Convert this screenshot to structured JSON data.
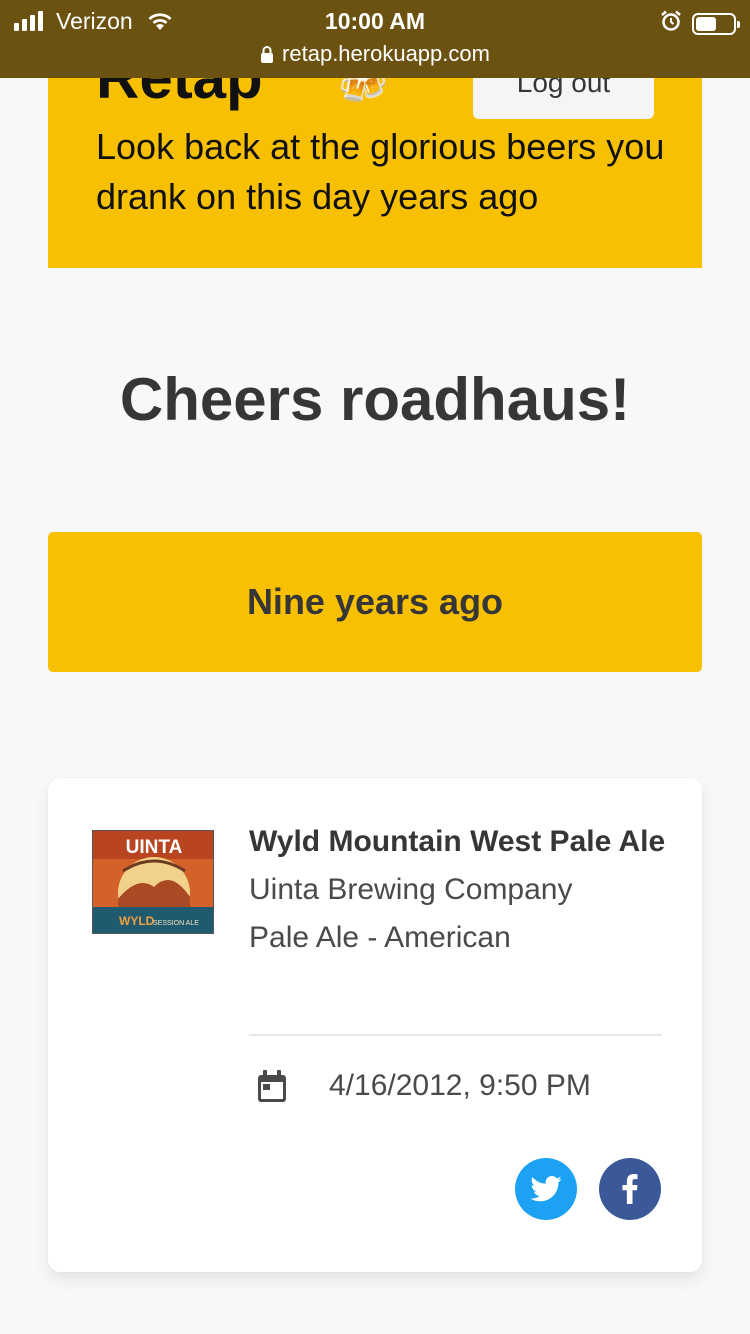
{
  "status_bar": {
    "carrier": "Verizon",
    "time": "10:00 AM",
    "url": "retap.herokuapp.com"
  },
  "hero": {
    "title": "Retap",
    "emoji": "🍻",
    "logout_label": "Log out",
    "subtitle": "Look back at the glorious beers you drank on this day years ago"
  },
  "greeting": "Cheers roadhaus!",
  "section": {
    "years_label": "Nine years ago"
  },
  "checkin": {
    "beer_label_brand": "UINTA",
    "beer_label_name": "WYLD",
    "beer_label_sub": "SESSION ALE",
    "beer_name": "Wyld Mountain West Pale Ale",
    "brewery": "Uinta Brewing Company",
    "style": "Pale Ale - American",
    "date": "4/16/2012, 9:50 PM"
  },
  "colors": {
    "accent": "#f8c002",
    "twitter": "#1da1f2",
    "facebook": "#3b5998"
  }
}
